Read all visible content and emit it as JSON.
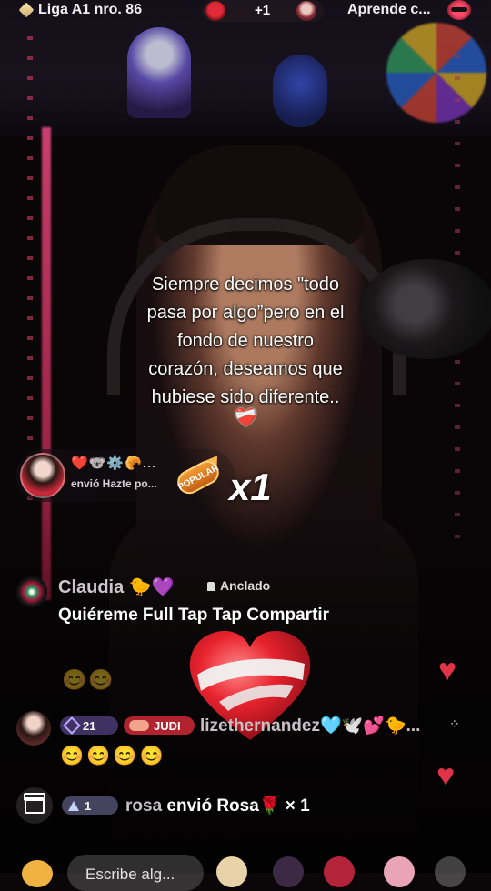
{
  "top_bar": {
    "league_label": "Liga A1 nro. 86",
    "viewers_extra": "+1",
    "learn_label": "Aprende c..."
  },
  "caption": {
    "lines": [
      "Siempre decimos \"todo",
      "pasa por algo”pero en el",
      "fondo de nuestro",
      "corazón, deseamos que",
      "hubiese sido diferente.."
    ],
    "heart": "❤️‍🩹"
  },
  "gift_banner": {
    "emojis": "❤️🐨⚙️🥐...",
    "subtitle": "envió Hazte po...",
    "badge": "POPULAR",
    "combo": "x1"
  },
  "pinned_message": {
    "user": "Claudia 🐤💜",
    "tag": "Anclado",
    "text": "Quiéreme Full Tap Tap Compartir"
  },
  "faded_emojis": "😊😊",
  "chat_message": {
    "level": "21",
    "team_badge": "JUDI",
    "user": "lizethernandez🩵🕊️💕🐤...",
    "text": "😊😊😊😊"
  },
  "gift_line": {
    "level": "1",
    "user": "rosa",
    "action": "envió Rosa",
    "rose_icon": "🌹",
    "count": "× 1"
  },
  "bottom_bar": {
    "input_placeholder": "Escribe alg..."
  },
  "colors": {
    "accent_red": "#e0334a",
    "badge_purple": "#46376e",
    "badge_judi": "#b0232f"
  }
}
